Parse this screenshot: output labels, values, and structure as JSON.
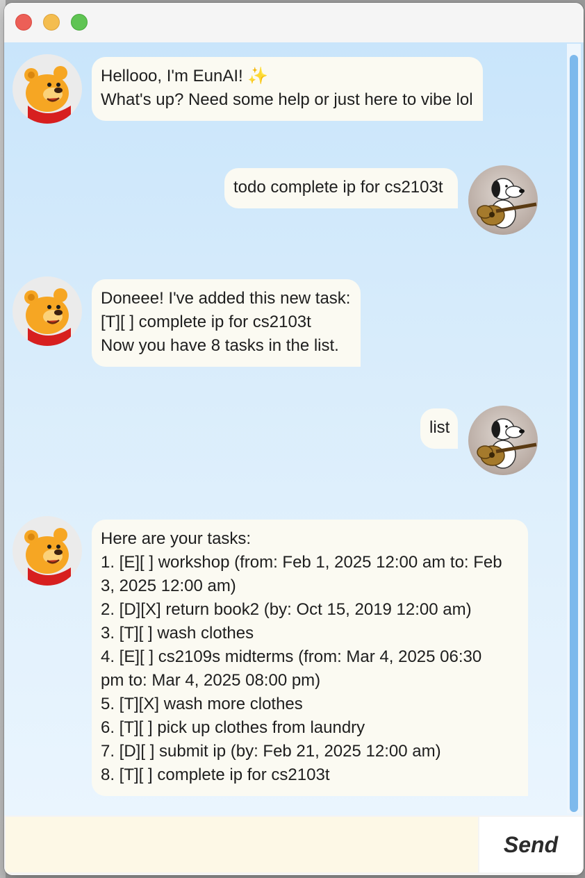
{
  "window": {
    "controls": [
      "close",
      "minimize",
      "maximize"
    ]
  },
  "chat": {
    "messages": [
      {
        "sender": "bot",
        "lines": [
          "Hellooo, I'm EunAI! ✨",
          "What's up? Need some help or just here to vibe lol"
        ]
      },
      {
        "sender": "user",
        "lines": [
          "todo complete ip for cs2103t"
        ]
      },
      {
        "sender": "bot",
        "lines": [
          "Doneee! I've added this new task:",
          "[T][ ] complete ip for cs2103t",
          "Now you have 8 tasks in the list."
        ]
      },
      {
        "sender": "user",
        "lines": [
          "list"
        ]
      },
      {
        "sender": "bot",
        "lines": [
          "Here are your tasks:",
          "1. [E][ ] workshop (from: Feb 1, 2025 12:00 am to: Feb",
          "3, 2025 12:00 am)",
          "2. [D][X] return book2 (by: Oct 15, 2019 12:00 am)",
          "3. [T][ ] wash clothes",
          "4. [E][ ] cs2109s midterms (from: Mar 4, 2025 06:30",
          "pm to: Mar 4, 2025 08:00 pm)",
          "5. [T][X] wash more clothes",
          "6. [T][ ] pick up clothes from laundry",
          "7. [D][ ] submit ip (by: Feb 21, 2025 12:00 am)",
          "8. [T][ ] complete ip for cs2103t"
        ]
      }
    ],
    "bot_avatar_icon": "pooh-bear-avatar-icon",
    "user_avatar_icon": "snoopy-guitar-avatar-icon"
  },
  "input": {
    "value": "",
    "placeholder": "",
    "send_label": "Send"
  },
  "colors": {
    "bubble": "#fbfaf2",
    "chat_bg_top": "#c9e5fb",
    "scroll_thumb": "#7db9ec",
    "input_bg": "#fdf8e6"
  }
}
